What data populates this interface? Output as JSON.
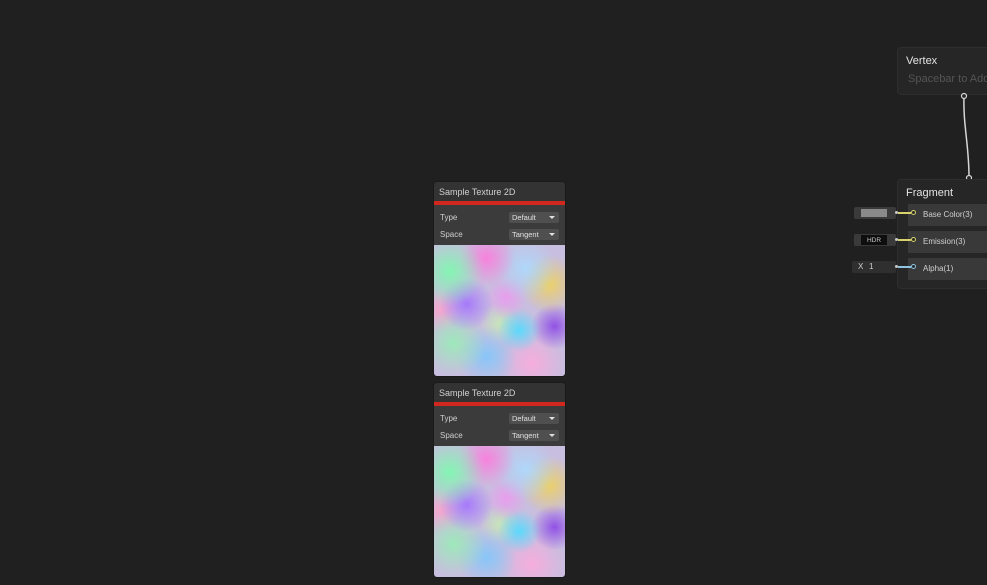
{
  "nodes": [
    {
      "title": "Sample Texture 2D",
      "properties": [
        {
          "label": "Type",
          "value": "Default"
        },
        {
          "label": "Space",
          "value": "Tangent"
        }
      ]
    },
    {
      "title": "Sample Texture 2D",
      "properties": [
        {
          "label": "Type",
          "value": "Default"
        },
        {
          "label": "Space",
          "value": "Tangent"
        }
      ]
    }
  ],
  "vertex": {
    "title": "Vertex",
    "placeholder": "Spacebar to Add"
  },
  "fragment": {
    "title": "Fragment",
    "blocks": [
      {
        "label": "Base Color(3)"
      },
      {
        "label": "Emission(3)"
      },
      {
        "label": "Alpha(1)"
      }
    ],
    "inputs": {
      "emission_hdr": "HDR",
      "alpha_axis": "X",
      "alpha_value": "1"
    }
  },
  "colors": {
    "background": "#202020",
    "node_header_bar": "#d0281e",
    "port_color": "#d7d36a",
    "port_float": "#8fc4e3"
  }
}
